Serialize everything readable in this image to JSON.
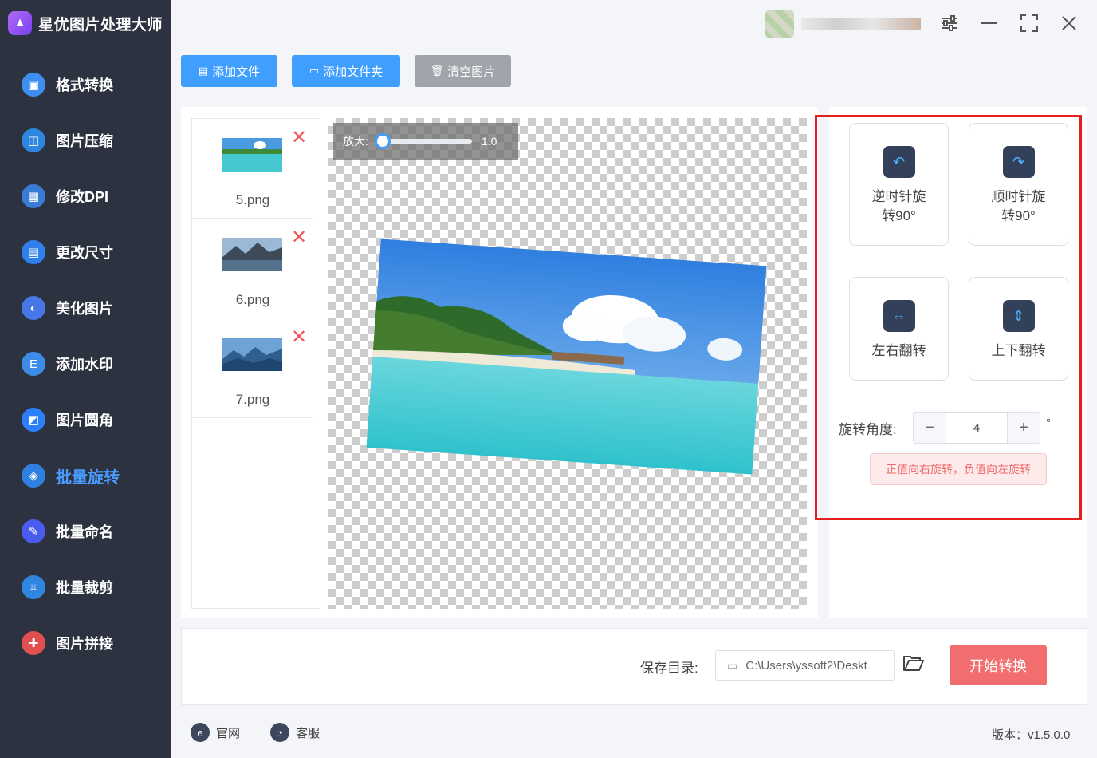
{
  "app": {
    "title": "星优图片处理大师"
  },
  "sidebar": {
    "items": [
      {
        "label": "格式转换",
        "icon": "image-convert-icon",
        "color": "#3d8ef0"
      },
      {
        "label": "图片压缩",
        "icon": "image-compress-icon",
        "color": "#2e86de"
      },
      {
        "label": "修改DPI",
        "icon": "dpi-icon",
        "color": "#3a7bd5"
      },
      {
        "label": "更改尺寸",
        "icon": "resize-icon",
        "color": "#2f80ed"
      },
      {
        "label": "美化图片",
        "icon": "beautify-icon",
        "color": "#4776e6"
      },
      {
        "label": "添加水印",
        "icon": "watermark-icon",
        "color": "#3c8ce7"
      },
      {
        "label": "图片圆角",
        "icon": "round-corner-icon",
        "color": "#2d7ff9"
      },
      {
        "label": "批量旋转",
        "icon": "rotate-icon",
        "color": "#2f7fe0"
      },
      {
        "label": "批量命名",
        "icon": "rename-icon",
        "color": "#4a5cf0"
      },
      {
        "label": "批量裁剪",
        "icon": "crop-icon",
        "color": "#2f86e0"
      },
      {
        "label": "图片拼接",
        "icon": "puzzle-icon",
        "color": "#e05050"
      }
    ],
    "active_index": 7
  },
  "toolbar": {
    "add_file": "添加文件",
    "add_folder": "添加文件夹",
    "clear": "清空图片"
  },
  "files": [
    {
      "name": "5.png"
    },
    {
      "name": "6.png"
    },
    {
      "name": "7.png"
    }
  ],
  "preview": {
    "zoom_label": "放大:",
    "zoom_value": "1.0",
    "rotation_deg": 4
  },
  "operations": {
    "ccw": "逆时针旋转90°",
    "ccw_line1": "逆时针旋",
    "ccw_line2": "转90°",
    "cw": "顺时针旋转90°",
    "cw_line1": "顺时针旋",
    "cw_line2": "转90°",
    "flip_h": "左右翻转",
    "flip_v": "上下翻转"
  },
  "angle": {
    "label": "旋转角度:",
    "value": "4",
    "unit": "°",
    "minus": "−",
    "plus": "+",
    "hint": "正值向右旋转，负值向左旋转"
  },
  "save": {
    "label": "保存目录:",
    "path": "C:\\Users\\yssoft2\\Deskt",
    "start": "开始转换"
  },
  "footer": {
    "website": "官网",
    "support": "客服",
    "version": "版本：v1.5.0.0"
  },
  "colors": {
    "sidebar_bg": "#2d3240",
    "accent": "#409eff",
    "start_button": "#f26d6d",
    "highlight": "#e41f1f"
  }
}
